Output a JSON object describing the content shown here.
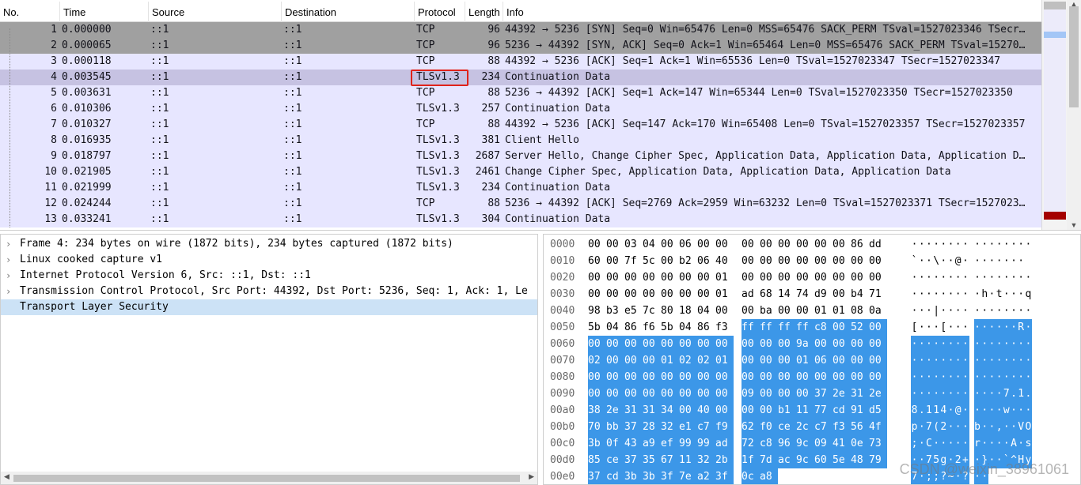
{
  "packet_list": {
    "columns": [
      "No.",
      "Time",
      "Source",
      "Destination",
      "Protocol",
      "Length",
      "Info"
    ],
    "rows": [
      {
        "no": "1",
        "time": "0.000000",
        "src": "::1",
        "dst": "::1",
        "proto": "TCP",
        "len": "96",
        "info": "44392 → 5236 [SYN] Seq=0 Win=65476 Len=0 MSS=65476 SACK_PERM TSval=1527023346 TSecr…",
        "color": "syn"
      },
      {
        "no": "2",
        "time": "0.000065",
        "src": "::1",
        "dst": "::1",
        "proto": "TCP",
        "len": "96",
        "info": "5236 → 44392 [SYN, ACK] Seq=0 Ack=1 Win=65464 Len=0 MSS=65476 SACK_PERM TSval=15270…",
        "color": "syn"
      },
      {
        "no": "3",
        "time": "0.000118",
        "src": "::1",
        "dst": "::1",
        "proto": "TCP",
        "len": "88",
        "info": "44392 → 5236 [ACK] Seq=1 Ack=1 Win=65536 Len=0 TSval=1527023347 TSecr=1527023347",
        "color": "tcp"
      },
      {
        "no": "4",
        "time": "0.003545",
        "src": "::1",
        "dst": "::1",
        "proto": "TLSv1.3",
        "len": "234",
        "info": "Continuation Data",
        "color": "sel"
      },
      {
        "no": "5",
        "time": "0.003631",
        "src": "::1",
        "dst": "::1",
        "proto": "TCP",
        "len": "88",
        "info": "5236 → 44392 [ACK] Seq=1 Ack=147 Win=65344 Len=0 TSval=1527023350 TSecr=1527023350",
        "color": "tcp"
      },
      {
        "no": "6",
        "time": "0.010306",
        "src": "::1",
        "dst": "::1",
        "proto": "TLSv1.3",
        "len": "257",
        "info": "Continuation Data",
        "color": "tcp"
      },
      {
        "no": "7",
        "time": "0.010327",
        "src": "::1",
        "dst": "::1",
        "proto": "TCP",
        "len": "88",
        "info": "44392 → 5236 [ACK] Seq=147 Ack=170 Win=65408 Len=0 TSval=1527023357 TSecr=1527023357",
        "color": "tcp"
      },
      {
        "no": "8",
        "time": "0.016935",
        "src": "::1",
        "dst": "::1",
        "proto": "TLSv1.3",
        "len": "381",
        "info": "Client Hello",
        "color": "tcp"
      },
      {
        "no": "9",
        "time": "0.018797",
        "src": "::1",
        "dst": "::1",
        "proto": "TLSv1.3",
        "len": "2687",
        "info": "Server Hello, Change Cipher Spec, Application Data, Application Data, Application D…",
        "color": "tcp"
      },
      {
        "no": "10",
        "time": "0.021905",
        "src": "::1",
        "dst": "::1",
        "proto": "TLSv1.3",
        "len": "2461",
        "info": "Change Cipher Spec, Application Data, Application Data, Application Data",
        "color": "tcp"
      },
      {
        "no": "11",
        "time": "0.021999",
        "src": "::1",
        "dst": "::1",
        "proto": "TLSv1.3",
        "len": "234",
        "info": "Continuation Data",
        "color": "tcp"
      },
      {
        "no": "12",
        "time": "0.024244",
        "src": "::1",
        "dst": "::1",
        "proto": "TCP",
        "len": "88",
        "info": "5236 → 44392 [ACK] Seq=2769 Ack=2959 Win=63232 Len=0 TSval=1527023371 TSecr=1527023…",
        "color": "tcp"
      },
      {
        "no": "13",
        "time": "0.033241",
        "src": "::1",
        "dst": "::1",
        "proto": "TLSv1.3",
        "len": "304",
        "info": "Continuation Data",
        "color": "tcp"
      }
    ]
  },
  "details": {
    "items": [
      {
        "text": "Frame 4: 234 bytes on wire (1872 bits), 234 bytes captured (1872 bits)",
        "expand": "›",
        "selected": false
      },
      {
        "text": "Linux cooked capture v1",
        "expand": "›",
        "selected": false
      },
      {
        "text": "Internet Protocol Version 6, Src: ::1, Dst: ::1",
        "expand": "›",
        "selected": false
      },
      {
        "text": "Transmission Control Protocol, Src Port: 44392, Dst Port: 5236, Seq: 1, Ack: 1, Le",
        "expand": "›",
        "selected": false
      },
      {
        "text": "Transport Layer Security",
        "expand": "",
        "selected": true
      }
    ]
  },
  "bytes": {
    "rows": [
      {
        "offset": "0000",
        "hex": [
          "00",
          "00",
          "03",
          "04",
          "00",
          "06",
          "00",
          "00",
          "00",
          "00",
          "00",
          "00",
          "00",
          "00",
          "86",
          "dd"
        ],
        "ascii": "········ ········",
        "hl": []
      },
      {
        "offset": "0010",
        "hex": [
          "60",
          "00",
          "7f",
          "5c",
          "00",
          "b2",
          "06",
          "40",
          "00",
          "00",
          "00",
          "00",
          "00",
          "00",
          "00",
          "00"
        ],
        "ascii": "`··\\··@ ········",
        "hl": []
      },
      {
        "offset": "0020",
        "hex": [
          "00",
          "00",
          "00",
          "00",
          "00",
          "00",
          "00",
          "01",
          "00",
          "00",
          "00",
          "00",
          "00",
          "00",
          "00",
          "00"
        ],
        "ascii": "········ ········",
        "hl": []
      },
      {
        "offset": "0030",
        "hex": [
          "00",
          "00",
          "00",
          "00",
          "00",
          "00",
          "00",
          "01",
          "ad",
          "68",
          "14",
          "74",
          "d9",
          "00",
          "b4",
          "71"
        ],
        "ascii": "········ ·h·t···q",
        "hl": []
      },
      {
        "offset": "0040",
        "hex": [
          "98",
          "b3",
          "e5",
          "7c",
          "80",
          "18",
          "04",
          "00",
          "00",
          "ba",
          "00",
          "00",
          "01",
          "01",
          "08",
          "0a"
        ],
        "ascii": "···|···· ········",
        "hl": []
      },
      {
        "offset": "0050",
        "hex": [
          "5b",
          "04",
          "86",
          "f6",
          "5b",
          "04",
          "86",
          "f3",
          "ff",
          "ff",
          "ff",
          "ff",
          "c8",
          "00",
          "52",
          "00"
        ],
        "ascii": "[···[··· ······R·",
        "hl": [
          8,
          9,
          10,
          11,
          12,
          13,
          14,
          15
        ]
      },
      {
        "offset": "0060",
        "hex": [
          "00",
          "00",
          "00",
          "00",
          "00",
          "00",
          "00",
          "00",
          "00",
          "00",
          "00",
          "9a",
          "00",
          "00",
          "00",
          "00"
        ],
        "ascii": "········ ········",
        "hl": [
          0,
          1,
          2,
          3,
          4,
          5,
          6,
          7,
          8,
          9,
          10,
          11,
          12,
          13,
          14,
          15
        ]
      },
      {
        "offset": "0070",
        "hex": [
          "02",
          "00",
          "00",
          "00",
          "01",
          "02",
          "02",
          "01",
          "00",
          "00",
          "00",
          "01",
          "06",
          "00",
          "00",
          "00"
        ],
        "ascii": "········ ········",
        "hl": [
          0,
          1,
          2,
          3,
          4,
          5,
          6,
          7,
          8,
          9,
          10,
          11,
          12,
          13,
          14,
          15
        ]
      },
      {
        "offset": "0080",
        "hex": [
          "00",
          "00",
          "00",
          "00",
          "00",
          "00",
          "00",
          "00",
          "00",
          "00",
          "00",
          "00",
          "00",
          "00",
          "00",
          "00"
        ],
        "ascii": "········ ········",
        "hl": [
          0,
          1,
          2,
          3,
          4,
          5,
          6,
          7,
          8,
          9,
          10,
          11,
          12,
          13,
          14,
          15
        ]
      },
      {
        "offset": "0090",
        "hex": [
          "00",
          "00",
          "00",
          "00",
          "00",
          "00",
          "00",
          "00",
          "09",
          "00",
          "00",
          "00",
          "37",
          "2e",
          "31",
          "2e"
        ],
        "ascii": "········ ····7.1.",
        "hl": [
          0,
          1,
          2,
          3,
          4,
          5,
          6,
          7,
          8,
          9,
          10,
          11,
          12,
          13,
          14,
          15
        ]
      },
      {
        "offset": "00a0",
        "hex": [
          "38",
          "2e",
          "31",
          "31",
          "34",
          "00",
          "40",
          "00",
          "00",
          "00",
          "b1",
          "11",
          "77",
          "cd",
          "91",
          "d5"
        ],
        "ascii": "8.114·@· ····w···",
        "hl": [
          0,
          1,
          2,
          3,
          4,
          5,
          6,
          7,
          8,
          9,
          10,
          11,
          12,
          13,
          14,
          15
        ]
      },
      {
        "offset": "00b0",
        "hex": [
          "70",
          "bb",
          "37",
          "28",
          "32",
          "e1",
          "c7",
          "f9",
          "62",
          "f0",
          "ce",
          "2c",
          "c7",
          "f3",
          "56",
          "4f"
        ],
        "ascii": "p·7(2··· b··,··VO",
        "hl": [
          0,
          1,
          2,
          3,
          4,
          5,
          6,
          7,
          8,
          9,
          10,
          11,
          12,
          13,
          14,
          15
        ]
      },
      {
        "offset": "00c0",
        "hex": [
          "3b",
          "0f",
          "43",
          "a9",
          "ef",
          "99",
          "99",
          "ad",
          "72",
          "c8",
          "96",
          "9c",
          "09",
          "41",
          "0e",
          "73"
        ],
        "ascii": ";·C····· r····A·s",
        "hl": [
          0,
          1,
          2,
          3,
          4,
          5,
          6,
          7,
          8,
          9,
          10,
          11,
          12,
          13,
          14,
          15
        ]
      },
      {
        "offset": "00d0",
        "hex": [
          "85",
          "ce",
          "37",
          "35",
          "67",
          "11",
          "32",
          "2b",
          "1f",
          "7d",
          "ac",
          "9c",
          "60",
          "5e",
          "48",
          "79"
        ],
        "ascii": "··75g·2+ ·}··`^Hy",
        "hl": [
          0,
          1,
          2,
          3,
          4,
          5,
          6,
          7,
          8,
          9,
          10,
          11,
          12,
          13,
          14,
          15
        ]
      },
      {
        "offset": "00e0",
        "hex": [
          "37",
          "cd",
          "3b",
          "3b",
          "3f",
          "7e",
          "a2",
          "3f",
          "0c",
          "a8"
        ],
        "ascii": "7·;;?~·? ··",
        "hl": [
          0,
          1,
          2,
          3,
          4,
          5,
          6,
          7,
          8,
          9
        ]
      }
    ]
  },
  "watermark": "CSDN @weixin_38961061",
  "colors": {
    "syn_row": "#a0a0a0",
    "tcp_row": "#e7e6ff",
    "selected_row": "#c6c2e2",
    "highlight_box": "#e0231a",
    "byte_highlight": "#3c97e8",
    "detail_selected": "#cce2f6"
  }
}
